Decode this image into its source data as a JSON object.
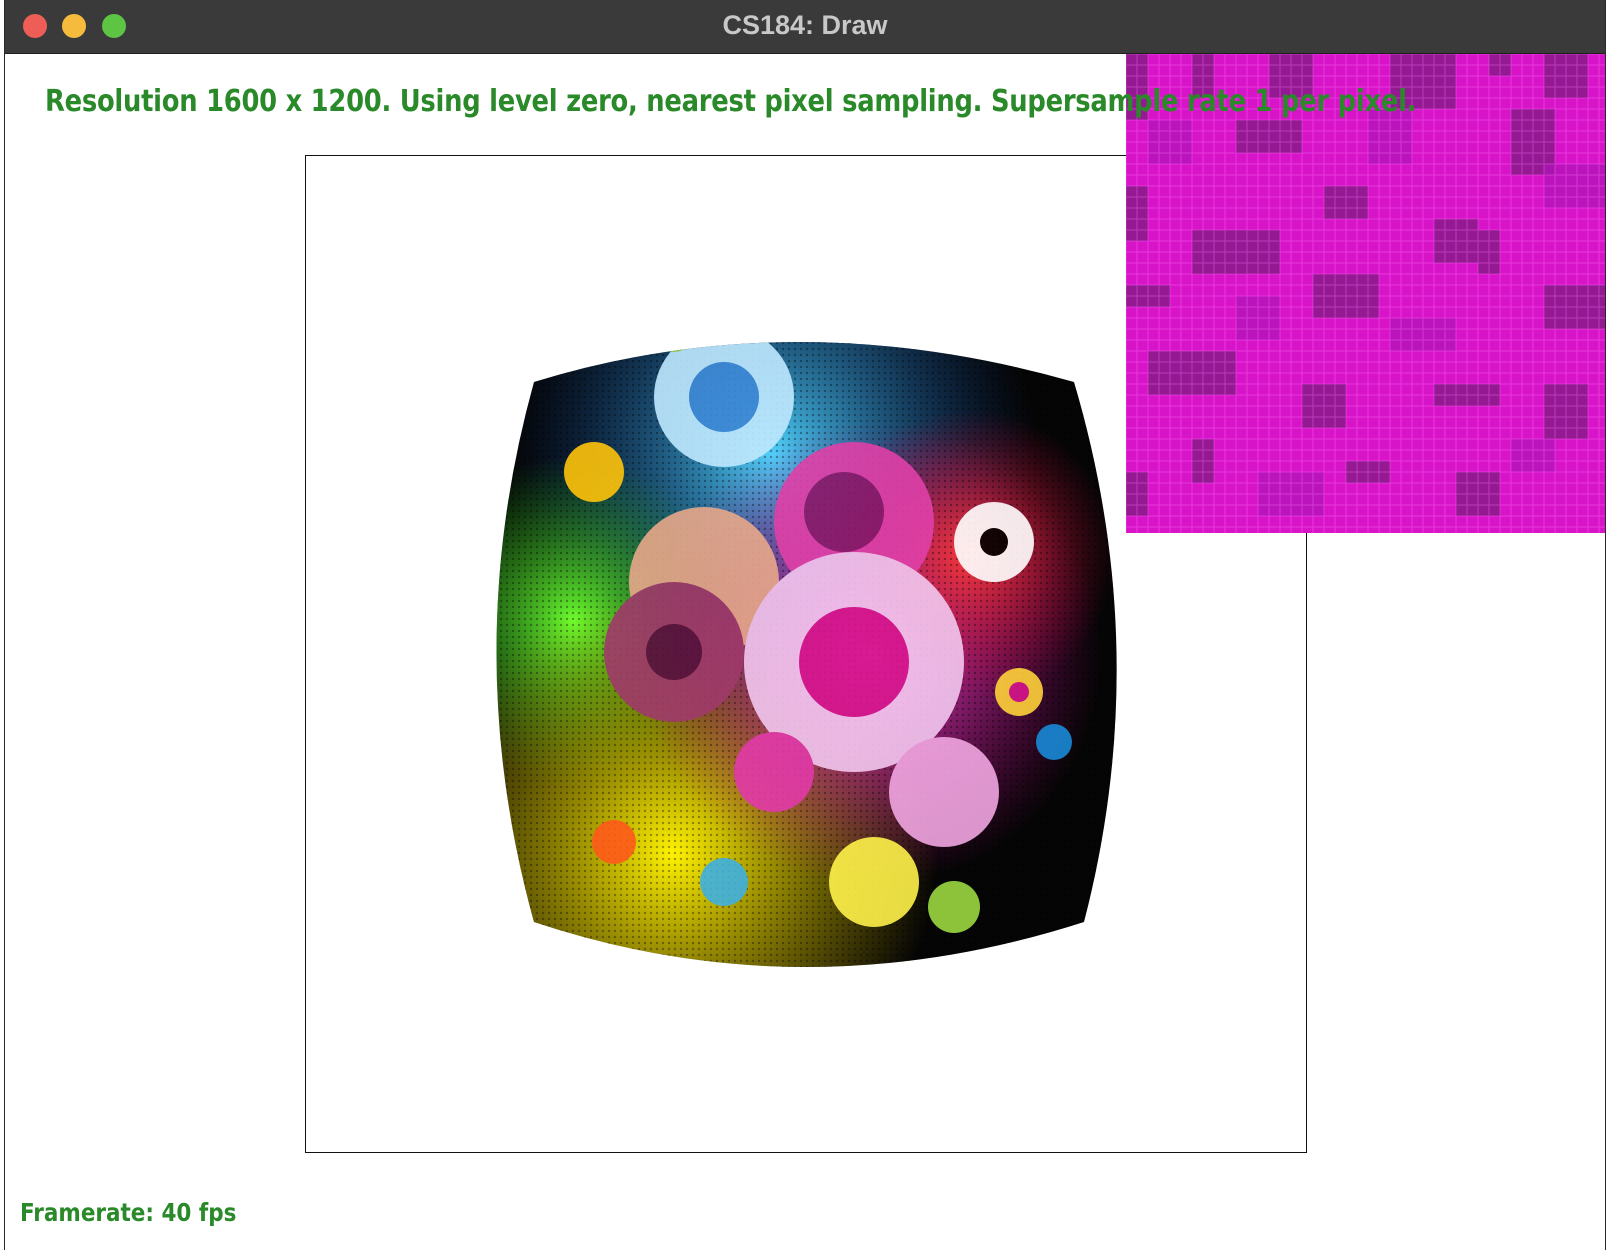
{
  "window": {
    "title": "CS184: Draw",
    "controls": [
      "close",
      "minimize",
      "maximize"
    ]
  },
  "status": {
    "resolution_text": "Resolution 1600 x 1200. Using level zero, nearest pixel sampling. Supersample rate 1 per pixel.",
    "framerate_text": "Framerate: 40 fps"
  },
  "colors": {
    "status_text": "#2a8a2a",
    "zoom_base": "#d814c8",
    "zoom_dark": "#8a1a8a",
    "title_bar": "#3a3a3a"
  },
  "icons": [
    "close-icon",
    "minimize-icon",
    "maximize-icon"
  ]
}
